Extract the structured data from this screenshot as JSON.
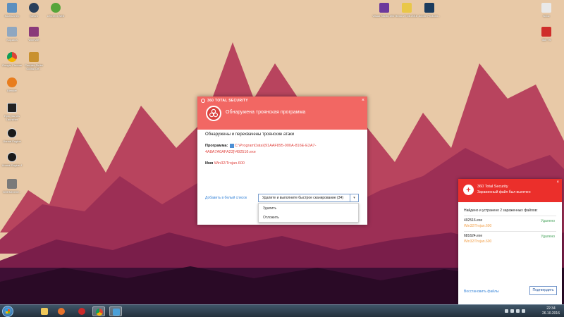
{
  "desktop": {
    "icons": [
      {
        "label": "Компьютер",
        "color": "#5b8fbf"
      },
      {
        "label": "Steam",
        "color": "#2a3f5a"
      },
      {
        "label": "uTorrent Web",
        "color": "#57a53b"
      },
      {
        "label": "Корзина",
        "color": "#8fa7c0"
      },
      {
        "label": "WinRAR",
        "color": "#8a3a7a"
      },
      {
        "label": "Google Chrome",
        "color": "#3d8bd7"
      },
      {
        "label": "Counter-Strike Global Off...",
        "color": "#c9912f"
      },
      {
        "label": "Blender",
        "color": "#e87d1e"
      },
      {
        "label": "Epic Games Launcher",
        "color": "#222222"
      },
      {
        "label": "Unreal Engine",
        "color": "#1a1a1a"
      },
      {
        "label": "Unreal Engine 4",
        "color": "#1a1a1a"
      },
      {
        "label": "DHEMKIGW...",
        "color": "#7a7a7a"
      },
      {
        "label": "Visual Studio 2017",
        "color": "#6d3a9c"
      },
      {
        "label": "Блок 27.08.2016",
        "color": "#e9c748"
      },
      {
        "label": "Adobe Photosh...",
        "color": "#1c3c5e"
      },
      {
        "label": "Блок",
        "color": "#e9e9e9"
      },
      {
        "label": "360 TS",
        "color": "#cf2e2b"
      }
    ]
  },
  "dialog": {
    "brand": "360 TOTAL SECURITY",
    "close": "×",
    "title": "Обнаружена троянская программа",
    "subtitle": "Обнаружены и перехвачены троянские атаки",
    "program_label": "Программа:",
    "program_path": "C:\\ProgramData\\{91AAF895-000A-816E-E2A7-4A8A7A0AFA23}\\492516.exe",
    "name_label": "Имя",
    "name_value": "Win32/Trojan.600",
    "whitelist_link": "Добавить в белый список",
    "action_selected": "Удалите и выполните быстрое сканирование (34)",
    "action_options": [
      "Удалить",
      "Отложить"
    ]
  },
  "notification": {
    "app": "360 Total Security",
    "message": "Зараженный файл был вылечен",
    "close": "×",
    "found": "Найдено и устранено 2 зараженных файлов:",
    "files": [
      {
        "file": "492516.exe",
        "threat": "Win32/Trojan.600",
        "status": "Удалено"
      },
      {
        "file": "681624.exe",
        "threat": "Win32/Trojan.600",
        "status": "Удалено"
      }
    ],
    "restore_link": "Восстановить файлы",
    "confirm_button": "Подтвердить"
  },
  "taskbar": {
    "time": "22:34",
    "date": "26.10.2016",
    "apps": [
      {
        "name": "Windows Explorer",
        "color": "#f0c85a"
      },
      {
        "name": "Media Player",
        "color": "#e8732c"
      },
      {
        "name": "Recorder",
        "color": "#cc2a2a"
      },
      {
        "name": "Google Chrome",
        "color": "#3d8bd7"
      },
      {
        "name": "360 Total Security",
        "color": "#4aa0d8"
      }
    ]
  },
  "colors": {
    "alert_header": "#f26763",
    "notify_header": "#eb2f2b",
    "link": "#3a86d9",
    "threat_text": "#e0443f",
    "removed": "#46a35b"
  }
}
